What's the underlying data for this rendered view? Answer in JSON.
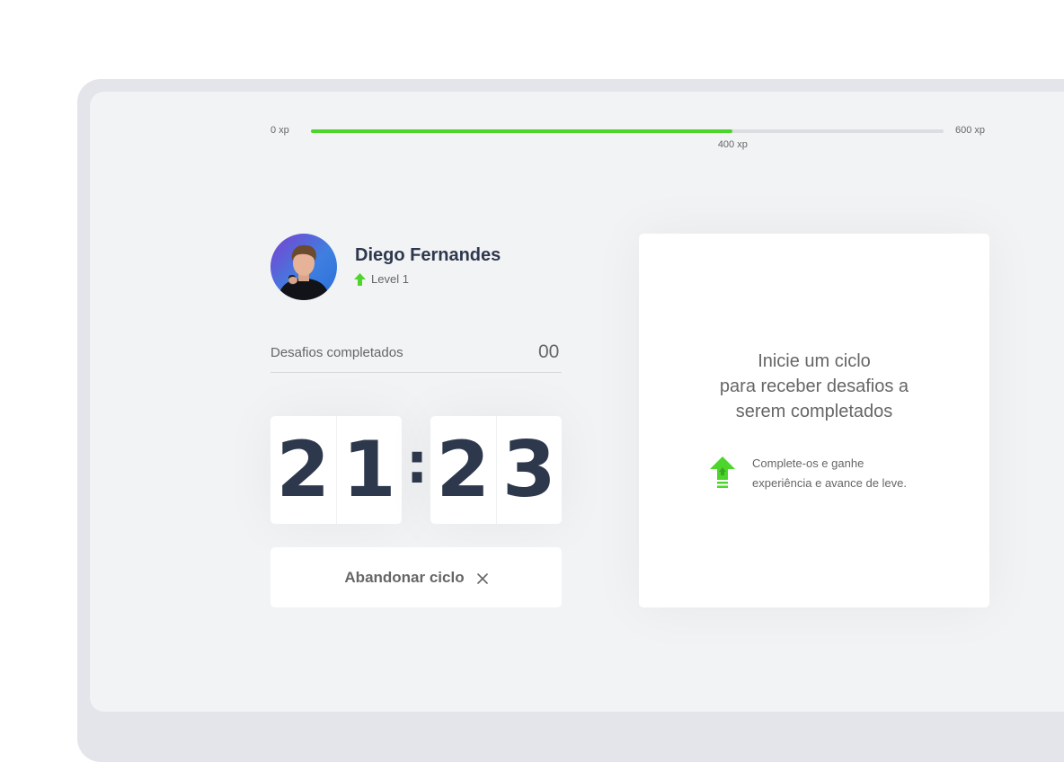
{
  "experience": {
    "min_label": "0 xp",
    "max_label": "600 xp",
    "current_label": "400 xp",
    "current": 400,
    "max": 600,
    "fill_color": "#4cd62b"
  },
  "profile": {
    "name": "Diego Fernandes",
    "level_label": "Level 1",
    "level_icon": "level-up-arrow-icon"
  },
  "challenges": {
    "label": "Desafios completados",
    "count": "00"
  },
  "countdown": {
    "minutes": [
      "2",
      "1"
    ],
    "separator": ":",
    "seconds": [
      "2",
      "3"
    ]
  },
  "actions": {
    "abandon_label": "Abandonar ciclo",
    "abandon_icon": "close-icon"
  },
  "challenge_card": {
    "title_lines": [
      "Inicie um ciclo",
      "para receber desafios a",
      "serem completados"
    ],
    "hint_lines": [
      "Complete-os e ganhe",
      "experiência e avance de leve."
    ],
    "hint_icon": "level-up-arrow-icon"
  },
  "colors": {
    "accent_green": "#4cd62b",
    "text_title": "#2e384d",
    "text_body": "#666666",
    "background": "#f2f3f5"
  }
}
